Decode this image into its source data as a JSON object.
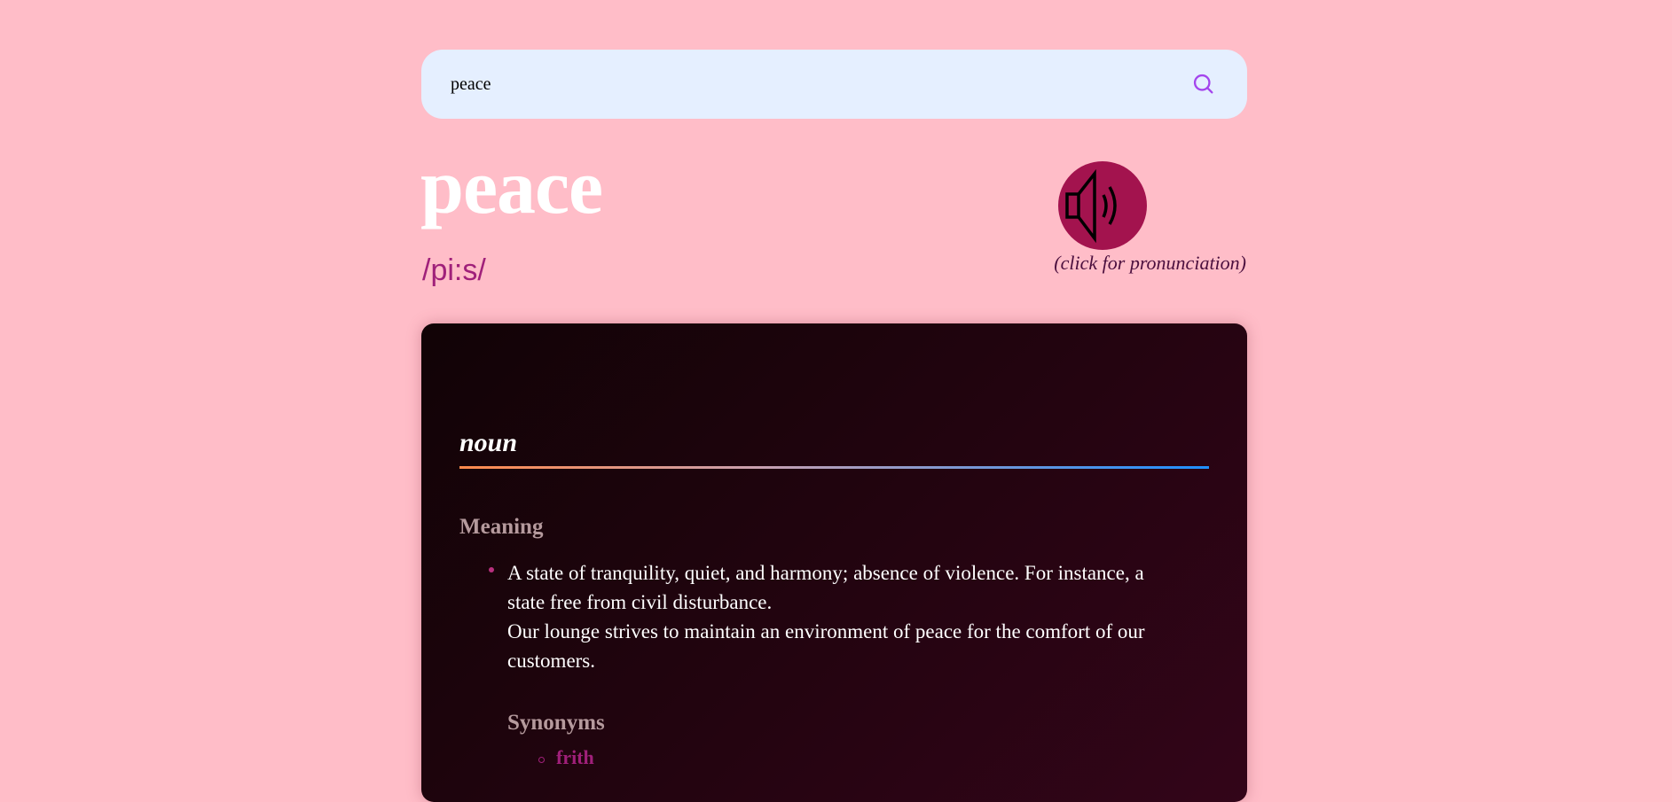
{
  "search": {
    "value": "peace",
    "icon": "search-icon",
    "icon_color": "#a445ed"
  },
  "entry": {
    "word": "peace",
    "phonetic": "/pi:s/",
    "audio": {
      "icon": "speaker-icon",
      "caption": "(click for pronunciation)",
      "color": "#a3134e"
    }
  },
  "meanings": [
    {
      "part_of_speech": "noun",
      "heading": "Meaning",
      "definitions": [
        {
          "text": "A state of tranquility, quiet, and harmony; absence of violence. For instance, a state free from civil disturbance.",
          "example": "Our lounge strives to maintain an environment of peace for the comfort of our customers."
        }
      ],
      "synonyms_heading": "Synonyms",
      "synonyms": [
        "frith"
      ]
    }
  ]
}
